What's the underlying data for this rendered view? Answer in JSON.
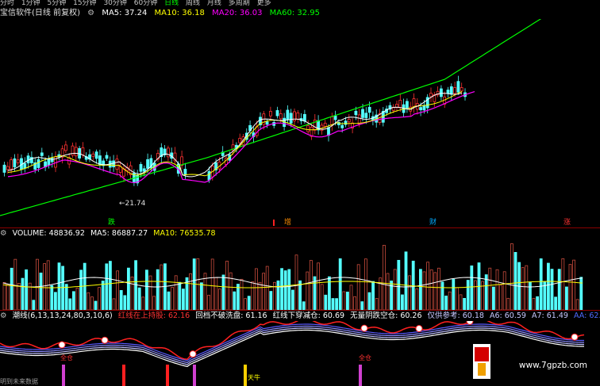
{
  "top_menu": {
    "items": [
      "分时",
      "1分钟",
      "5分钟",
      "15分钟",
      "30分钟",
      "60分钟",
      "日线",
      "周线",
      "月线",
      "多周期",
      "更多"
    ]
  },
  "price_panel": {
    "title": "宝信软件(日线 前复权)",
    "ma5": "MA5: 37.24",
    "ma10": "MA10: 36.18",
    "ma20": "MA20: 36.03",
    "ma60": "MA60: 32.95",
    "low_label": "←21.74",
    "signals": [
      "跌",
      "增",
      "财",
      "涨"
    ],
    "colors": {
      "ma5": "#ffffff",
      "ma10": "#ffff00",
      "ma20": "#ff00ff",
      "ma60": "#00ff00",
      "up": "#ff3232",
      "down": "#54ffff"
    }
  },
  "volume_panel": {
    "volume": "VOLUME: 48836.92",
    "ma5": "MA5: 86887.27",
    "ma10": "MA10: 76535.78"
  },
  "indicator_panel": {
    "name": "潮线(6,13,13,24,80,3,10,6)",
    "hold": "红线在上持股: 62.16",
    "pullback": "回档不破洗盘: 61.16",
    "reduce": "红线下穿减仓: 60.69",
    "no_risk": "无量阴跌空仓: 60.26",
    "ref": "仅供参考: 60.18",
    "a6": "A6: 60.59",
    "a7": "A7: 61.49",
    "aa": "AA: 62.46",
    "labels": [
      "全仓",
      "全仓",
      "天牛"
    ]
  },
  "footer": {
    "left_text": "明到未来数据",
    "watermark": "www.7gpzb.com"
  }
}
